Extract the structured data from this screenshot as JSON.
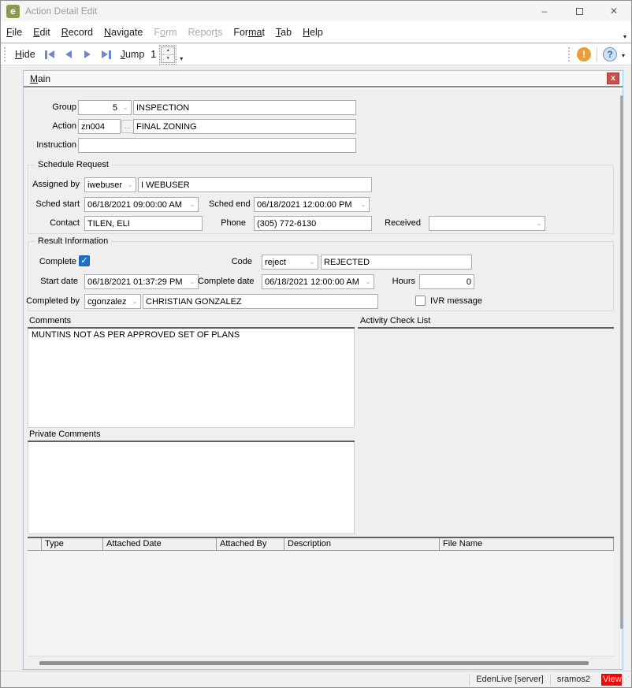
{
  "window": {
    "title": "Action Detail Edit",
    "icon_letter": "e",
    "minimize_icon": "–",
    "close_icon": "✕"
  },
  "icons": {
    "chevron": "⌄",
    "ellipsis": "…",
    "spin_up": "▲",
    "spin_down": "▼",
    "overflow": "▾",
    "alert": "!",
    "help": "?",
    "check": "✓",
    "grip": "⋰"
  },
  "menu": {
    "items": [
      {
        "pre": "",
        "key": "F",
        "post": "ile",
        "disabled": false
      },
      {
        "pre": "",
        "key": "E",
        "post": "dit",
        "disabled": false
      },
      {
        "pre": "",
        "key": "R",
        "post": "ecord",
        "disabled": false
      },
      {
        "pre": "",
        "key": "N",
        "post": "avigate",
        "disabled": false
      },
      {
        "pre": "F",
        "key": "o",
        "post": "rm",
        "disabled": true
      },
      {
        "pre": "Repor",
        "key": "t",
        "post": "s",
        "disabled": true
      },
      {
        "pre": "For",
        "key": "ma",
        "post": "t",
        "disabled": false
      },
      {
        "pre": "",
        "key": "T",
        "post": "ab",
        "disabled": false
      },
      {
        "pre": "",
        "key": "H",
        "post": "elp",
        "disabled": false
      }
    ]
  },
  "toolbar": {
    "hide": {
      "pre": "",
      "key": "H",
      "post": "ide"
    },
    "jump": {
      "pre": "",
      "key": "J",
      "post": "ump"
    },
    "jump_value": "1"
  },
  "panel": {
    "tab": {
      "key": "M",
      "post": "ain"
    },
    "close_icon": "x"
  },
  "fields": {
    "group": {
      "label": "Group",
      "code": "5",
      "desc": "INSPECTION"
    },
    "action": {
      "label": "Action",
      "code": "zn004",
      "desc": "FINAL ZONING"
    },
    "instruction": {
      "label": "Instruction",
      "value": ""
    },
    "schedule": {
      "title": "Schedule Request",
      "assigned": {
        "label": "Assigned by",
        "code": "iwebuser",
        "desc": "I WEBUSER"
      },
      "sched_start": {
        "label": "Sched start",
        "value": "06/18/2021 09:00:00 AM"
      },
      "sched_end": {
        "label": "Sched end",
        "value": "06/18/2021 12:00:00 PM"
      },
      "contact": {
        "label": "Contact",
        "value": "TILEN, ELI"
      },
      "phone": {
        "label": "Phone",
        "value": "(305) 772-6130"
      },
      "received": {
        "label": "Received",
        "value": ""
      }
    },
    "result": {
      "title": "Result Information",
      "complete": {
        "label": "Complete",
        "checked": true
      },
      "code": {
        "label": "Code",
        "code": "reject",
        "desc": "REJECTED"
      },
      "start_date": {
        "label": "Start date",
        "value": "06/18/2021 01:37:29 PM"
      },
      "complete_date": {
        "label": "Complete date",
        "value": "06/18/2021 12:00:00 AM"
      },
      "hours": {
        "label": "Hours",
        "value": "0"
      },
      "completed_by": {
        "label": "Completed by",
        "code": "cgonzalez",
        "desc": "CHRISTIAN GONZALEZ"
      },
      "ivr": {
        "label": "IVR message",
        "checked": false
      }
    }
  },
  "sections": {
    "comments_label": "Comments",
    "activity_label": "Activity Check List",
    "private_label": "Private Comments"
  },
  "comments_value": "MUNTINS NOT AS PER APPROVED SET OF PLANS",
  "private_value": "",
  "attachments": {
    "columns": [
      "",
      "Type",
      "Attached Date",
      "Attached By",
      "Description",
      "File Name"
    ],
    "rows": []
  },
  "statusbar": {
    "server": "EdenLive [server]",
    "user": "sramos2",
    "mode": "View"
  },
  "colors": {
    "checkbox_accent": "#1f6fc8",
    "panel_close_red": "#c9504c",
    "status_mode_red": "#ff0000",
    "nav_arrow_blue": "#6e87cf",
    "alert_orange": "#eb9e36",
    "panel_border_blue": "#a7c9e8",
    "app_icon_green": "#8b9a4d"
  }
}
